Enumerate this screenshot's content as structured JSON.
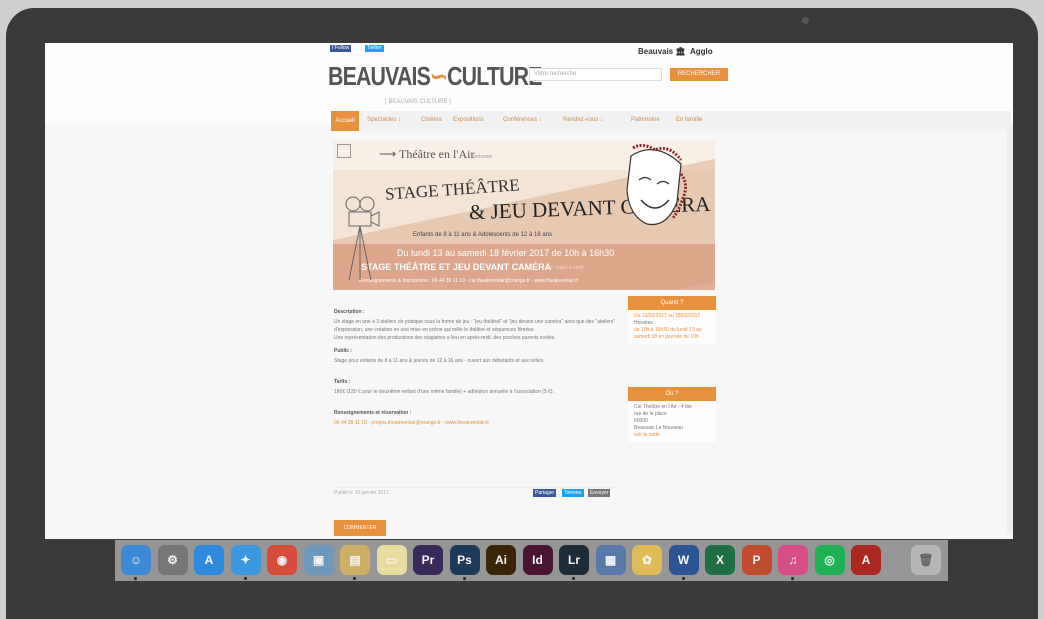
{
  "site": {
    "logo_left": "BEAUVAIS",
    "logo_mid": "∽",
    "logo_right": "CULTURE",
    "logo_sub": "[ BEAUVAIS CULTURE ]",
    "social_fb": "f Follow",
    "social_tw": "Twitter",
    "partner1": "Beauvais 🏛",
    "partner2": "Agglo",
    "search_placeholder": "Votre recherche",
    "search_button": "RECHERCHER"
  },
  "nav": {
    "items": [
      "Accueil",
      "Spectacles ↓",
      "Cinéma",
      "Expositions",
      "Conférences ↓",
      "Rendez-vous ↓",
      "Patrimoine",
      "En famille"
    ]
  },
  "banner": {
    "title_small": "Théâtre en l'Air",
    "title_small_sub": "présente",
    "line1": "STAGE THÉÂTRE",
    "line2": "& JEU DEVANT CAMÉRA",
    "ages": "Enfants de 8 à 11 ans & Adolescents de 12 à 16 ans",
    "dates": "Du lundi 13 au samedi 18 février 2017 de 10h à 16h30",
    "stage": "STAGE THÉÂTRE ET JEU DEVANT CAMÉRA",
    "stage_note": "sur dates à venir",
    "footer": "Renseignements & inscriptions : 06 44 39 11 10 - cie.theatreenlair@orange.fr - www.theatreenlair.fr"
  },
  "article": {
    "desc_h": "Description :",
    "desc1a": "Un stage en une à 3 ateliers de pratique sous la forme de jeu : \"jeu théâtral\" et \"jeu devant une caméra\" ainsi que des \"ateliers\" d'expression, une création en une mise en scène qui mêle le théâtre et",
    "desc1b": "séquences filmées.",
    "desc2": "Une représentation des productions des stagiaires a lieu en après-midi, des proches parents invités.",
    "public_h": "Public :",
    "public": "Stage pour enfants de 8 à 11 ans & jeunes de 12 à 16 ans - ouvert aux débutants et aux initiés.",
    "tarifs_h": "Tarifs :",
    "tarifs": "180€ (130 € pour le deuxième enfant d'une même famille) + adhésion annuelle à l'association (5 €).",
    "renseign_h": "Renseignements et réservation :",
    "renseign": "06 44 39 11 10 - projets.theatreenlair@orange.fr - www.theatreenlair.fr",
    "published": "Publié le 15 janvier 2017",
    "share1": "Partager",
    "share2": "Tweeter",
    "share3": "Envoyer",
    "comment_btn": "COMMENTER"
  },
  "sidebar": {
    "when_h": "Quand ?",
    "when_dates": "Du 13/02/2017 au 18/02/2017",
    "when_hours_label": "Horaires :",
    "when_hours": "de 10h à 16h30 du lundi 13 au samedi 18 en journée de 10h",
    "where_h": "Où ?",
    "where1": "Cie Théâtre en l'Air - 4 bis",
    "where2": "rue de la place",
    "where3": "60000",
    "where4": "Beauvais Le Nouveau",
    "where5": "voir la carte"
  },
  "dock": {
    "items": [
      {
        "name": "finder-icon",
        "label": "☺",
        "color": "#3d8fe0"
      },
      {
        "name": "system-preferences-icon",
        "label": "⚙",
        "color": "#7a7a7a"
      },
      {
        "name": "app-store-icon",
        "label": "A",
        "color": "#2f8fe6"
      },
      {
        "name": "safari-icon",
        "label": "✦",
        "color": "#3c9ee8"
      },
      {
        "name": "chrome-icon",
        "label": "◉",
        "color": "#e04c3b"
      },
      {
        "name": "preview-icon",
        "label": "▣",
        "color": "#6fa0c7"
      },
      {
        "name": "notes-icon",
        "label": "▤",
        "color": "#d7b56a"
      },
      {
        "name": "stickies-icon",
        "label": "▭",
        "color": "#f1e6a6"
      },
      {
        "name": "premiere-icon",
        "label": "Pr",
        "color": "#3b2a5e"
      },
      {
        "name": "photoshop-icon",
        "label": "Ps",
        "color": "#1c3a5c"
      },
      {
        "name": "illustrator-icon",
        "label": "Ai",
        "color": "#3b2405"
      },
      {
        "name": "indesign-icon",
        "label": "Id",
        "color": "#4b1333"
      },
      {
        "name": "lightroom-icon",
        "label": "Lr",
        "color": "#1d2b38"
      },
      {
        "name": "photos-library-icon",
        "label": "▦",
        "color": "#5a7db0"
      },
      {
        "name": "photos-icon",
        "label": "✿",
        "color": "#e8c35a"
      },
      {
        "name": "word-icon",
        "label": "W",
        "color": "#2b5797"
      },
      {
        "name": "excel-icon",
        "label": "X",
        "color": "#1e7145"
      },
      {
        "name": "powerpoint-icon",
        "label": "P",
        "color": "#c84b2c"
      },
      {
        "name": "itunes-icon",
        "label": "♫",
        "color": "#e0508c"
      },
      {
        "name": "spotify-icon",
        "label": "◎",
        "color": "#1db954"
      },
      {
        "name": "acrobat-icon",
        "label": "A",
        "color": "#b3261e"
      },
      {
        "name": "trash-icon",
        "label": "🗑",
        "color": "#bdbdbd"
      }
    ]
  }
}
